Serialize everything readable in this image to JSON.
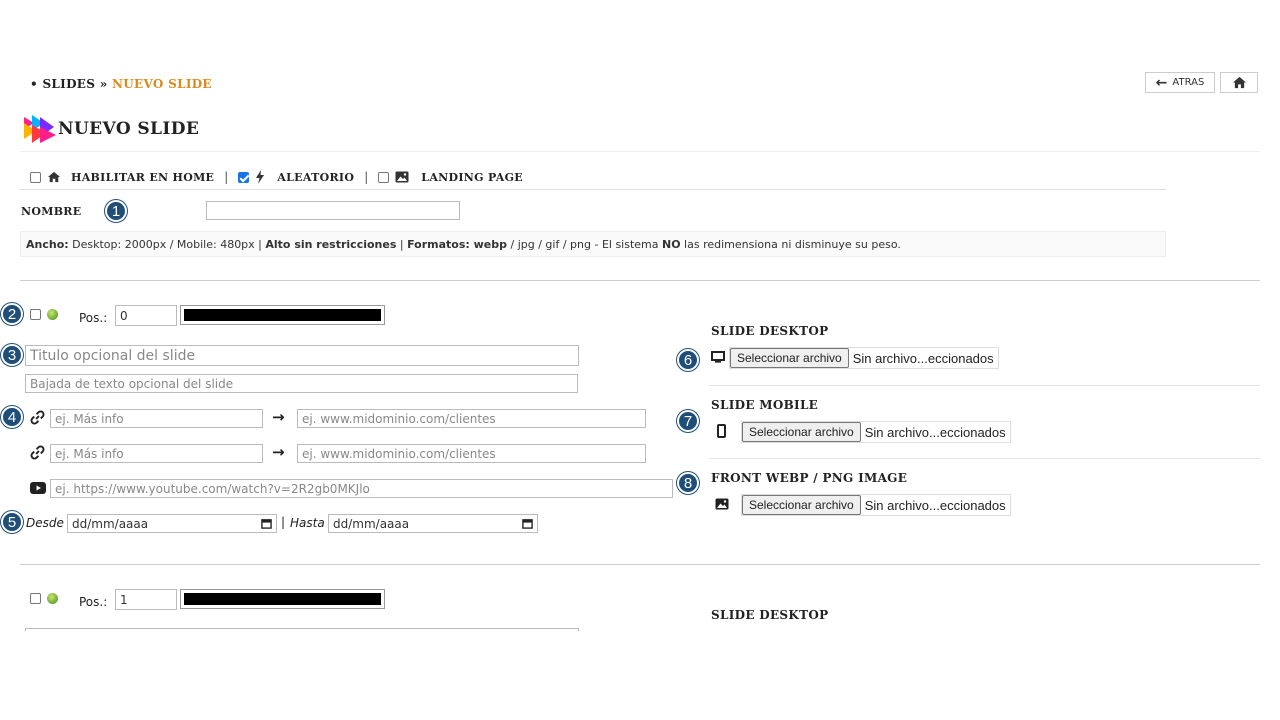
{
  "breadcrumb": {
    "bullet": "•",
    "parent": "SLIDES",
    "sep": "»",
    "current": "NUEVO SLIDE"
  },
  "top_buttons": {
    "back_label": "ATRAS"
  },
  "page": {
    "title": "NUEVO SLIDE"
  },
  "options": {
    "home": {
      "label": "HABILITAR EN HOME",
      "checked": false
    },
    "random": {
      "label": "ALEATORIO",
      "checked": true
    },
    "landing": {
      "label": "LANDING PAGE",
      "checked": false
    },
    "sep": "|"
  },
  "nombre": {
    "label": "NOMBRE",
    "value": ""
  },
  "info": {
    "ancho_label": "Ancho:",
    "ancho_text": " Desktop: 2000px / Mobile: 480px | ",
    "alto": "Alto sin restricciones",
    "sep1": " | ",
    "formatos_label": "Formatos: webp",
    "formatos_text": " / jpg / gif / png - El sistema ",
    "no": "NO",
    "tail": " las redimensiona ni disminuye su peso."
  },
  "markers": [
    "1",
    "2",
    "3",
    "4",
    "5",
    "6",
    "7",
    "8"
  ],
  "slide1": {
    "pos_label": "Pos.:",
    "pos_value": "0",
    "title_placeholder": "Titulo opcional del slide",
    "subtitle_placeholder": "Bajada de texto opcional del slide",
    "link_text_placeholder": "ej. Más info",
    "link_url_placeholder": "ej. www.midominio.com/clientes",
    "youtube_placeholder": "ej. https://www.youtube.com/watch?v=2R2gb0MKJlo",
    "desde_label": "Desde",
    "hasta_label": "Hasta",
    "date_placeholder": "dd/mm/aaaa",
    "date_sep": "|",
    "desktop_title": "SLIDE DESKTOP",
    "mobile_title": "SLIDE MOBILE",
    "front_title": "FRONT WEBP / PNG IMAGE",
    "file_button": "Seleccionar archivo",
    "file_status": "Sin archivo...eccionados"
  },
  "slide2": {
    "pos_label": "Pos.:",
    "pos_value": "1",
    "desktop_title": "SLIDE DESKTOP"
  },
  "colors": {
    "accent": "#d98b1b",
    "marker": "#1f4e79",
    "check": "#1a73e8"
  },
  "icons": [
    "home-icon",
    "bolt-icon",
    "image-icon",
    "link-icon",
    "arrow-right-icon",
    "youtube-icon",
    "calendar-icon",
    "monitor-icon",
    "mobile-icon",
    "arrow-left-icon",
    "check-ok-icon",
    "slides-logo-icon"
  ]
}
